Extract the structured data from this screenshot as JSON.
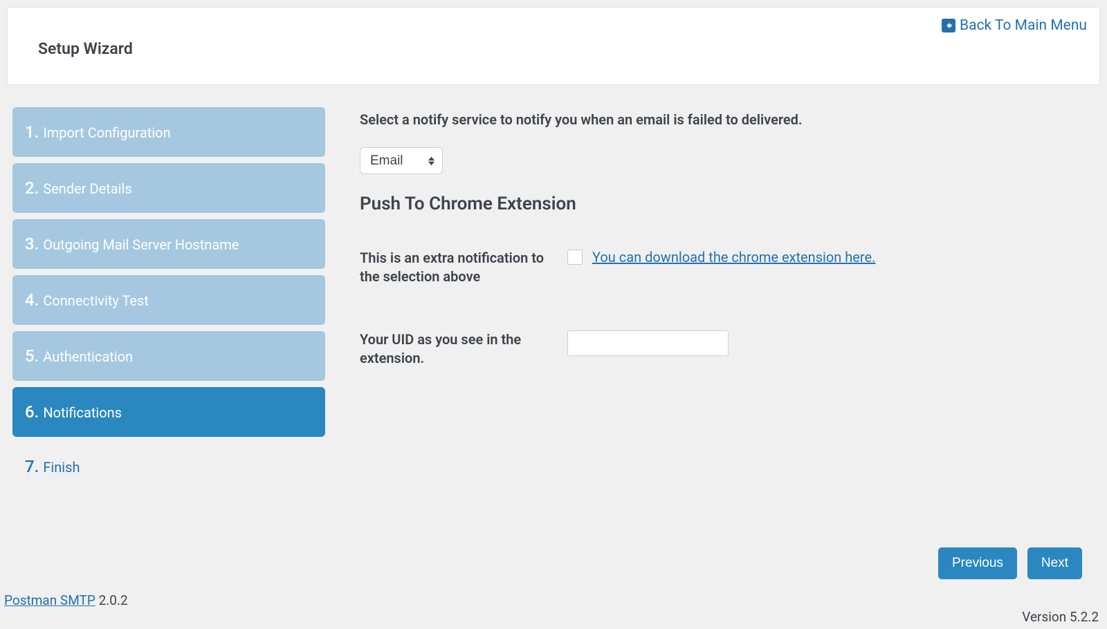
{
  "header": {
    "back_label": "Back To Main Menu",
    "title": "Setup Wizard"
  },
  "sidebar": {
    "steps": [
      {
        "num": "1.",
        "label": "Import Configuration"
      },
      {
        "num": "2.",
        "label": "Sender Details"
      },
      {
        "num": "3.",
        "label": "Outgoing Mail Server Hostname"
      },
      {
        "num": "4.",
        "label": "Connectivity Test"
      },
      {
        "num": "5.",
        "label": "Authentication"
      },
      {
        "num": "6.",
        "label": "Notifications"
      },
      {
        "num": "7.",
        "label": "Finish"
      }
    ]
  },
  "main": {
    "instruction": "Select a notify service to notify you when an email is failed to delivered.",
    "notify_select_value": "Email",
    "section_title": "Push To Chrome Extension",
    "extra_notif_label": "This is an extra notification to the selection above",
    "download_link": "You can download the chrome extension here.",
    "uid_label": "Your UID as you see in the extension.",
    "uid_value": ""
  },
  "nav": {
    "prev": "Previous",
    "next": "Next"
  },
  "footer": {
    "product_link": "Postman SMTP",
    "product_version": " 2.0.2",
    "wp_version": "Version 5.2.2"
  }
}
